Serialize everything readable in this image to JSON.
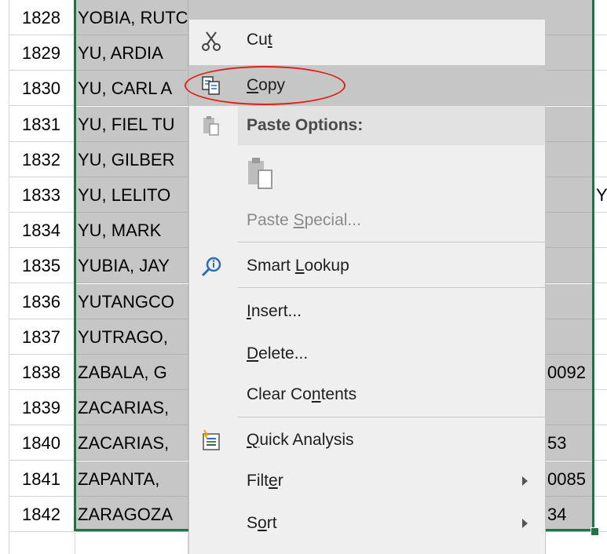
{
  "rows": [
    {
      "num": "1828",
      "name": "YOBIA, RUTCHEL AMASCUAL",
      "colC": "",
      "colD": ""
    },
    {
      "num": "1829",
      "name": "YU, ARDIA",
      "colC": "",
      "colD": ""
    },
    {
      "num": "1830",
      "name": "YU, CARL A",
      "colC": "",
      "colD": ""
    },
    {
      "num": "1831",
      "name": "YU, FIEL TU",
      "colC": "",
      "colD": ""
    },
    {
      "num": "1832",
      "name": "YU, GILBER",
      "colC": "",
      "colD": ""
    },
    {
      "num": "1833",
      "name": "YU, LELITO",
      "colC": "",
      "colD": "Y"
    },
    {
      "num": "1834",
      "name": "YU, MARK",
      "colC": "",
      "colD": ""
    },
    {
      "num": "1835",
      "name": "YUBIA, JAY",
      "colC": "",
      "colD": ""
    },
    {
      "num": "1836",
      "name": "YUTANGCO",
      "colC": "",
      "colD": ""
    },
    {
      "num": "1837",
      "name": "YUTRAGO,",
      "colC": "",
      "colD": ""
    },
    {
      "num": "1838",
      "name": "ZABALA, G",
      "colC": "0092",
      "colD": ""
    },
    {
      "num": "1839",
      "name": "ZACARIAS,",
      "colC": "",
      "colD": ""
    },
    {
      "num": "1840",
      "name": "ZACARIAS,",
      "colC": "53",
      "colD": ""
    },
    {
      "num": "1841",
      "name": "ZAPANTA,",
      "colC": "0085",
      "colD": ""
    },
    {
      "num": "1842",
      "name": "ZARAGOZA",
      "colC": "34",
      "colD": ""
    }
  ],
  "menu": {
    "cut": {
      "pre": "Cu",
      "u": "t",
      "post": "",
      "icon": "scissors-icon"
    },
    "copy": {
      "pre": "",
      "u": "C",
      "post": "opy",
      "icon": "copy-icon"
    },
    "paste_options": {
      "label": "Paste Options:",
      "icon": "paste-icon"
    },
    "paste_special": {
      "pre": "Paste ",
      "u": "S",
      "post": "pecial..."
    },
    "smart_lookup": {
      "pre": "Smart ",
      "u": "L",
      "post": "ookup",
      "icon": "smart-lookup-icon"
    },
    "insert": {
      "pre": "",
      "u": "I",
      "post": "nsert..."
    },
    "delete": {
      "pre": "",
      "u": "D",
      "post": "elete..."
    },
    "clear_contents": {
      "pre": "Clear Co",
      "u": "n",
      "post": "tents"
    },
    "quick_analysis": {
      "pre": "",
      "u": "Q",
      "post": "uick Analysis",
      "icon": "quick-analysis-icon"
    },
    "filter": {
      "pre": "Filt",
      "u": "e",
      "post": "r"
    },
    "sort": {
      "pre": "S",
      "u": "o",
      "post": "rt"
    }
  },
  "colors": {
    "selection_border": "#217346",
    "highlight_circle": "#e0201b"
  }
}
